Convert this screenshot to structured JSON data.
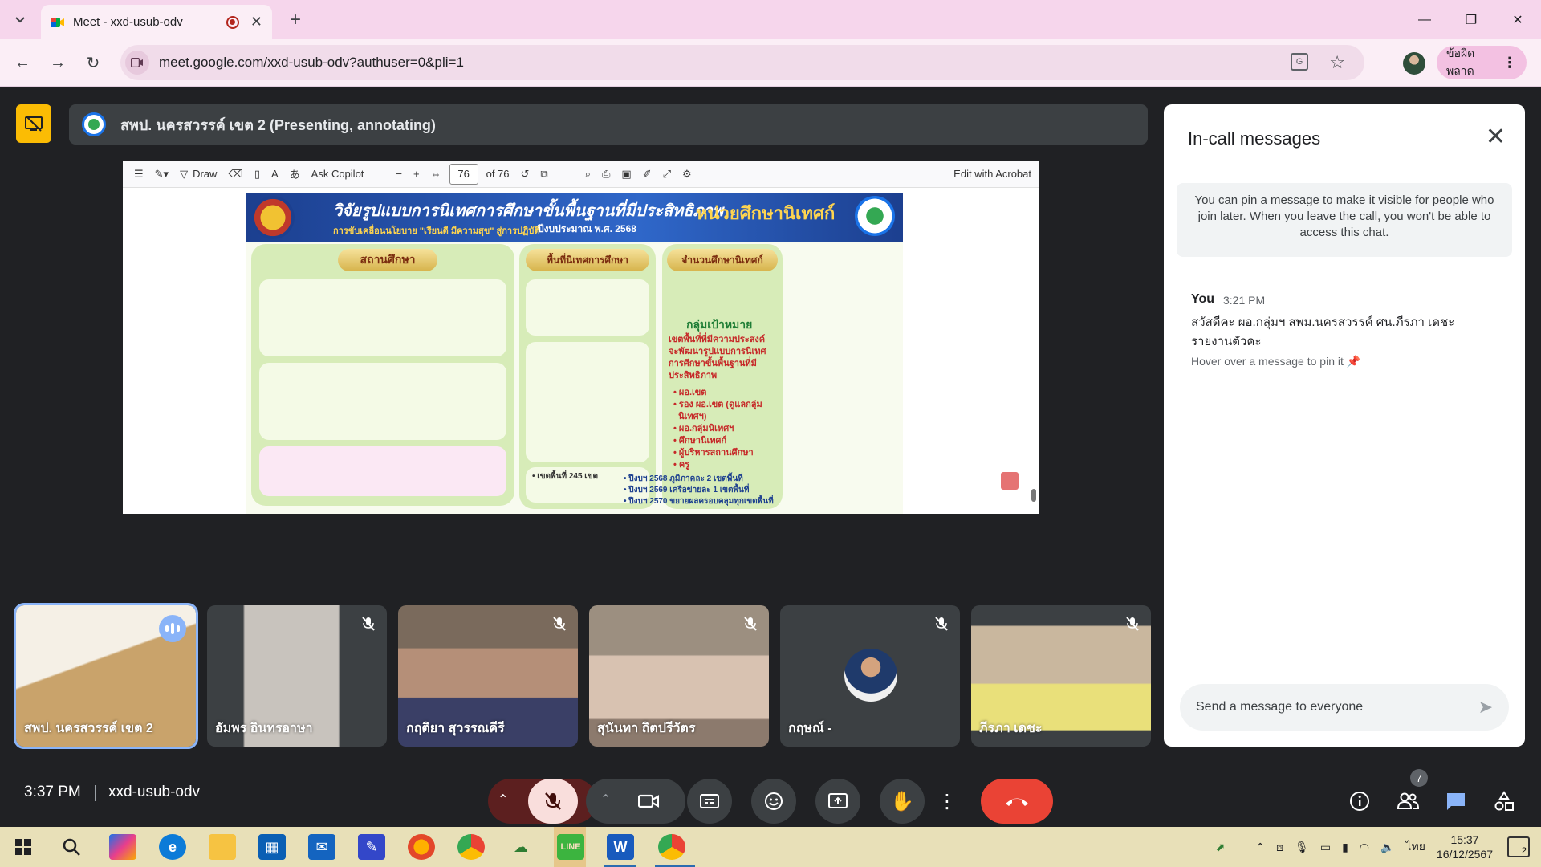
{
  "browser": {
    "tab_title": "Meet - xxd-usub-odv",
    "url": "meet.google.com/xxd-usub-odv?authuser=0&pli=1",
    "error_button": "ข้อผิดพลาด",
    "window_controls": [
      "minimize",
      "restore",
      "close"
    ]
  },
  "meet": {
    "presenter_title": "สพป. นครสวรรค์ เขต 2 (Presenting, annotating)",
    "pdf_toolbar": {
      "draw": "Draw",
      "copilot": "Ask Copilot",
      "page": "76",
      "of_pages": "of 76",
      "edit": "Edit with Acrobat"
    },
    "slide": {
      "title": "วิจัยรูปแบบการนิเทศการศึกษาขั้นพื้นฐานที่มีประสิทธิภาพ",
      "unit": "หน่วยศึกษานิเทศก์",
      "subtitle": "การขับเคลื่อนนโยบาย \"เรียนดี มีความสุข\" สู่การปฏิบัติ",
      "fiscal_year": "ปีงบประมาณ พ.ศ. 2568",
      "col1": "สถานศึกษา",
      "col2": "พื้นที่นิเทศการศึกษา",
      "col3": "จำนวนศึกษานิเทศก์",
      "target_heading": "กลุ่มเป้าหมาย",
      "target_text": "เขตพื้นที่ที่มีความประสงค์\nจะพัฒนารูปแบบการนิเทศ\nการศึกษาขั้นพื้นฐานที่มี\nประสิทธิภาพ",
      "target_list": "• ผอ.เขต\n• รอง ผอ.เขต (ดูแลกลุ่ม\n  นิเทศฯ)\n• ผอ.กลุ่มนิเทศฯ\n• ศึกษานิเทศก์\n• ผู้บริหารสถานศึกษา\n• ครู",
      "district_count": "• เขตพื้นที่ 245 เขต",
      "plan": "• ปีงบฯ 2568 ภูมิภาคละ 2 เขตพื้นที่\n• ปีงบฯ 2569 เครือข่ายละ 1 เขตพื้นที่\n• ปีงบฯ 2570 ขยายผลครอบคลุมทุกเขตพื้นที่"
    },
    "participants": [
      {
        "name": "สพป. นครสวรรค์ เขต 2",
        "state": "speaking"
      },
      {
        "name": "อัมพร อินทรอาษา",
        "state": "muted"
      },
      {
        "name": "กฤติยา สุวรรณคีรี",
        "state": "muted"
      },
      {
        "name": "สุนันทา ถิตปรีวัตร",
        "state": "muted"
      },
      {
        "name": "กฤษณ์ -",
        "state": "muted"
      },
      {
        "name": "ภีรภา เดชะ",
        "state": "muted"
      }
    ],
    "chat": {
      "title": "In-call messages",
      "info": "You can pin a message to make it visible for people who join later. When you leave the call, you won't be able to access this chat.",
      "sender": "You",
      "time": "3:21 PM",
      "message": "สวัสดีคะ ผอ.กลุ่มฯ สพม.นครสวรรค์ ศน.ภีรภา เดชะ รายงานตัวคะ",
      "hint": "Hover over a message to pin it",
      "placeholder": "Send a message to everyone"
    },
    "clock": "3:37 PM",
    "meeting_code": "xxd-usub-odv",
    "people_count": "7"
  },
  "taskbar": {
    "lang": "ไทย",
    "time": "15:37",
    "date": "16/12/2567",
    "notifications": "2"
  },
  "colors": {
    "end_call": "#ea4335",
    "speaking": "#8ab4f8",
    "tab_strip": "#f6d6ec"
  }
}
